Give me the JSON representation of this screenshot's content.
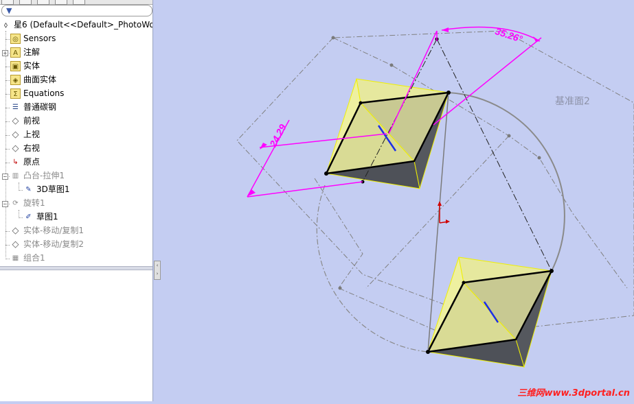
{
  "tree": {
    "root_label": "星6  (Default<<Default>_PhotoWor",
    "items": [
      {
        "label": "Sensors",
        "icon": "sensors-icon"
      },
      {
        "label": "注解",
        "icon": "annotations-icon"
      },
      {
        "label": "实体",
        "icon": "solid-bodies-icon"
      },
      {
        "label": "曲面实体",
        "icon": "surface-bodies-icon"
      },
      {
        "label": "Equations",
        "icon": "equations-icon"
      },
      {
        "label": "普通碳钢",
        "icon": "material-icon"
      },
      {
        "label": "前视",
        "icon": "plane-icon"
      },
      {
        "label": "上视",
        "icon": "plane-icon"
      },
      {
        "label": "右视",
        "icon": "plane-icon"
      },
      {
        "label": "原点",
        "icon": "origin-icon"
      },
      {
        "label": "凸台-拉伸1",
        "icon": "extrude-icon"
      },
      {
        "label": "3D草图1",
        "icon": "3dsketch-icon"
      },
      {
        "label": "旋转1",
        "icon": "revolve-icon"
      },
      {
        "label": "草图1",
        "icon": "sketch-icon"
      },
      {
        "label": "实体-移动/复制1",
        "icon": "move-copy-icon"
      },
      {
        "label": "实体-移动/复制2",
        "icon": "move-copy-icon"
      },
      {
        "label": "组合1",
        "icon": "combine-icon"
      }
    ]
  },
  "viewport": {
    "plane_label": "基准面2",
    "dim_angle": "35.26°",
    "dim_length": "24.29",
    "watermark": "三维网www.3dportal.cn"
  },
  "colors": {
    "background": "#c4cdf2",
    "dimension": "#ff00ff",
    "face_yellow": "#e6e89e",
    "face_dark": "#55585e"
  }
}
